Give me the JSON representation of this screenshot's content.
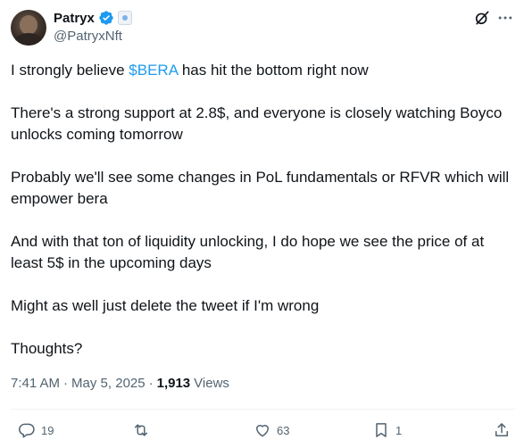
{
  "author": {
    "display_name": "Patryx",
    "handle": "@PatryxNft"
  },
  "tweet": {
    "paragraphs": [
      {
        "prefix": "I strongly believe ",
        "cashtag": "$BERA",
        "suffix": " has hit the bottom right now"
      },
      {
        "text": "There's a strong support at 2.8$, and everyone is closely watching Boyco unlocks coming tomorrow"
      },
      {
        "text": "Probably we'll see some changes in PoL fundamentals or RFVR which will empower bera"
      },
      {
        "text": "And with that ton of liquidity unlocking, I do hope we see the price of at least 5$ in the upcoming days"
      },
      {
        "text": "Might as well just delete the tweet if I'm wrong"
      },
      {
        "text": "Thoughts?"
      }
    ],
    "time": "7:41 AM",
    "date": "May 5, 2025",
    "views_count": "1,913",
    "views_label": "Views"
  },
  "actions": {
    "reply_count": "19",
    "repost_count": "",
    "like_count": "63",
    "bookmark_count": "1"
  },
  "colors": {
    "accent": "#1d9bf0",
    "text": "#0f1419",
    "muted": "#536471"
  },
  "icons": {
    "verified": "verified-badge-icon",
    "affiliate": "affiliate-badge-icon",
    "grok": "grok-icon",
    "more": "more-icon",
    "reply": "reply-icon",
    "repost": "repost-icon",
    "like": "like-icon",
    "bookmark": "bookmark-icon",
    "share": "share-icon"
  }
}
